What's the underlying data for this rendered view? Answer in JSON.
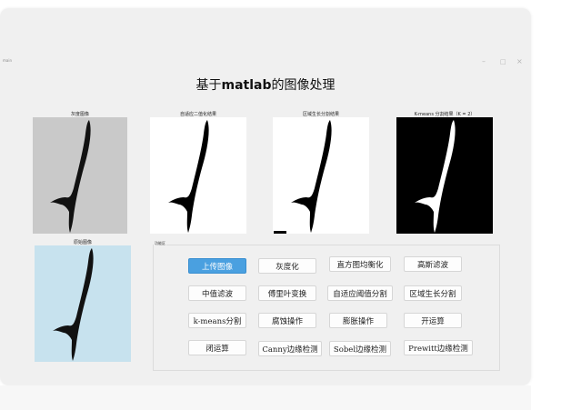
{
  "window": {
    "title": "main",
    "controls": {
      "minimize": "–",
      "maximize": "□",
      "close": "×"
    }
  },
  "header": {
    "title_prefix": "基于",
    "title_latin": "matlab",
    "title_suffix": "的图像处理"
  },
  "images": {
    "gray": {
      "label": "灰度图像"
    },
    "binary": {
      "label": "自适应二值化结果"
    },
    "region": {
      "label": "区域生长分割结果"
    },
    "kmeans": {
      "label": "K-means 分割结果（K = 2）"
    },
    "original": {
      "label": "原始图像"
    }
  },
  "panel": {
    "title": "功能区",
    "buttons": [
      {
        "label": "上传图像",
        "primary": true
      },
      {
        "label": "灰度化"
      },
      {
        "label": "直方图均衡化"
      },
      {
        "label": "高斯滤波"
      },
      {
        "label": "中值滤波"
      },
      {
        "label": "傅里叶变换"
      },
      {
        "label": "自适应阈值分割"
      },
      {
        "label": "区域生长分割"
      },
      {
        "label": "k-means分割"
      },
      {
        "label": "腐蚀操作"
      },
      {
        "label": "膨胀操作"
      },
      {
        "label": "开运算"
      },
      {
        "label": "闭运算"
      },
      {
        "label": "Canny边缘检测"
      },
      {
        "label": "Sobel边缘检测"
      },
      {
        "label": "Prewitt边缘检测"
      }
    ]
  },
  "colors": {
    "primary_button": "#4aa0e0",
    "gray_image_bg": "#c9c9c9",
    "original_image_bg": "#c7e2ee",
    "bird": "#111111"
  }
}
